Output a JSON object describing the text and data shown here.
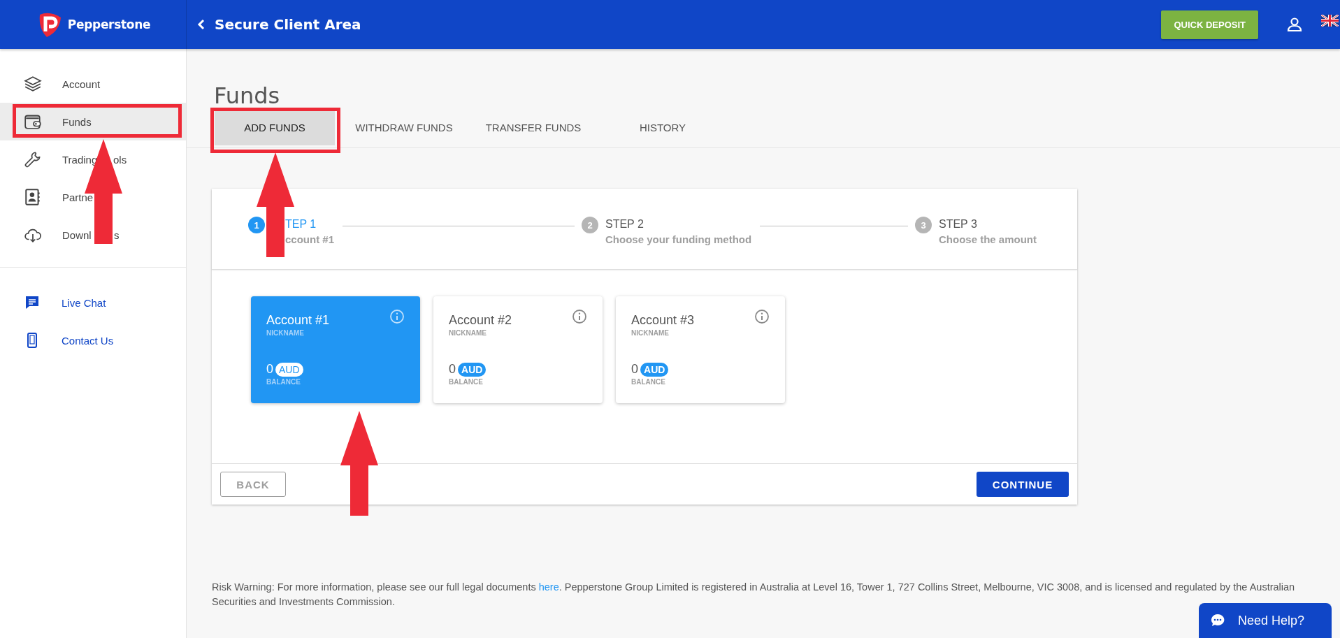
{
  "header": {
    "brand": "Pepperstone",
    "title": "Secure Client Area",
    "quick_deposit": "QUICK DEPOSIT"
  },
  "sidebar": {
    "items": [
      {
        "label": "Account",
        "selected": false
      },
      {
        "label": "Funds",
        "selected": true
      },
      {
        "label": "Trading",
        "label_tail": "ols",
        "selected": false
      },
      {
        "label": "Partne",
        "selected": false
      },
      {
        "label": "Downl",
        "label_tail": "s",
        "selected": false
      }
    ],
    "links": [
      {
        "label": "Live Chat"
      },
      {
        "label": "Contact Us"
      }
    ]
  },
  "page": {
    "title": "Funds",
    "tabs": [
      {
        "label": "ADD FUNDS",
        "selected": true
      },
      {
        "label": "WITHDRAW FUNDS",
        "selected": false
      },
      {
        "label": "TRANSFER FUNDS",
        "selected": false
      },
      {
        "label": "HISTORY",
        "selected": false
      }
    ]
  },
  "stepper": [
    {
      "number": "1",
      "title": "TEP 1",
      "subtitle": "ccount #1",
      "selected": true
    },
    {
      "number": "2",
      "title": "STEP 2",
      "subtitle": "Choose your funding method",
      "selected": false
    },
    {
      "number": "3",
      "title": "STEP 3",
      "subtitle": "Choose the amount",
      "selected": false
    }
  ],
  "accounts": [
    {
      "name": "Account #1",
      "nickname_label": "NICKNAME",
      "balance": "0",
      "currency": "AUD",
      "balance_label": "BALANCE",
      "selected": true
    },
    {
      "name": "Account #2",
      "nickname_label": "NICKNAME",
      "balance": "0",
      "currency": "AUD",
      "balance_label": "BALANCE",
      "selected": false
    },
    {
      "name": "Account #3",
      "nickname_label": "NICKNAME",
      "balance": "0",
      "currency": "AUD",
      "balance_label": "BALANCE",
      "selected": false
    }
  ],
  "buttons": {
    "back": "BACK",
    "continue": "CONTINUE"
  },
  "footer": {
    "before": "Risk Warning: For more information, please see our full legal documents ",
    "link": "here",
    "after": ". Pepperstone Group Limited is registered in Australia at Level 16, Tower 1, 727 Collins Street, Melbourne, VIC 3008, and is licensed and regulated by the Australian Securities and Investments Commission."
  },
  "help_button": "Need Help?",
  "annotations": [
    {
      "kind": "frame"
    },
    {
      "kind": "frame"
    },
    {
      "kind": "arrow"
    },
    {
      "kind": "arrow"
    },
    {
      "kind": "arrow"
    }
  ]
}
